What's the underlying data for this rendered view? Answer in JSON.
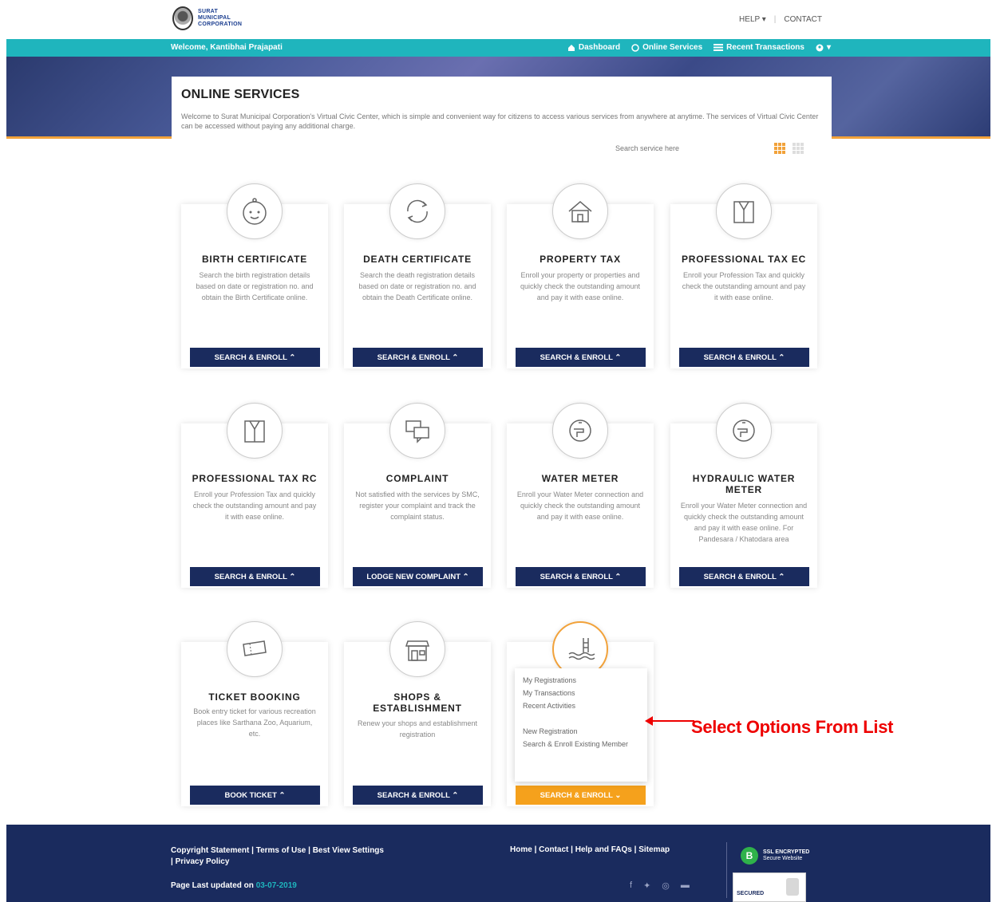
{
  "header": {
    "logo_line1": "SURAT",
    "logo_line2": "MUNICIPAL",
    "logo_line3": "CORPORATION",
    "help_label": "HELP ▾",
    "contact_label": "CONTACT"
  },
  "nav": {
    "welcome": "Welcome, Kantibhai Prajapati",
    "dashboard": "Dashboard",
    "online_services": "Online Services",
    "recent_transactions": "Recent Transactions",
    "user_menu": "▾"
  },
  "intro": {
    "title": "ONLINE SERVICES",
    "description": "Welcome to Surat Municipal Corporation's Virtual Civic Center, which is simple and convenient way for citizens to access various services from anywhere at anytime. The services of Virtual Civic Center can be accessed without paying any additional charge.",
    "search_placeholder": "Search service here"
  },
  "cards": [
    {
      "icon": "baby-icon",
      "title": "BIRTH CERTIFICATE",
      "desc": "Search the birth registration details based on date or registration no. and obtain the Birth Certificate online.",
      "button": "SEARCH & ENROLL ⌃"
    },
    {
      "icon": "cycle-icon",
      "title": "DEATH CERTIFICATE",
      "desc": "Search the death registration details based on date or registration no. and obtain the Death Certificate online.",
      "button": "SEARCH & ENROLL ⌃"
    },
    {
      "icon": "house-icon",
      "title": "PROPERTY TAX",
      "desc": "Enroll your property or properties and quickly check the outstanding amount and pay it with ease online.",
      "button": "SEARCH & ENROLL ⌃"
    },
    {
      "icon": "suit-icon",
      "title": "PROFESSIONAL TAX EC",
      "desc": "Enroll your Profession Tax and quickly check the outstanding amount and pay it with ease online.",
      "button": "SEARCH & ENROLL ⌃"
    },
    {
      "icon": "suit-icon",
      "title": "PROFESSIONAL TAX RC",
      "desc": "Enroll your Profession Tax and quickly check the outstanding amount and pay it with ease online.",
      "button": "SEARCH & ENROLL ⌃"
    },
    {
      "icon": "chat-icon",
      "title": "COMPLAINT",
      "desc": "Not satisfied with the services by SMC, register your complaint and track the complaint status.",
      "button": "LODGE NEW COMPLAINT ⌃"
    },
    {
      "icon": "water-tap-icon",
      "title": "WATER METER",
      "desc": "Enroll your Water Meter connection and quickly check the outstanding amount and pay it with ease online.",
      "button": "SEARCH & ENROLL ⌃"
    },
    {
      "icon": "water-tap-icon",
      "title": "HYDRAULIC WATER METER",
      "desc": "Enroll your Water Meter connection and quickly check the outstanding amount and pay it with ease online. For Pandesara / Khatodara area",
      "button": "SEARCH & ENROLL ⌃"
    },
    {
      "icon": "ticket-icon",
      "title": "TICKET BOOKING",
      "desc": "Book entry ticket for various recreation places like Sarthana Zoo, Aquarium, etc.",
      "button": "BOOK TICKET ⌃"
    },
    {
      "icon": "shop-icon",
      "title": "SHOPS & ESTABLISHMENT",
      "desc": "Renew your shops and establishment registration",
      "button": "SEARCH & ENROLL ⌃"
    },
    {
      "icon": "swimming-pool-icon",
      "title": "",
      "desc": "",
      "button": "SEARCH & ENROLL ⌄"
    }
  ],
  "dropdown": {
    "items": [
      "My Registrations",
      "My Transactions",
      "Recent Activities",
      "New Registration",
      "Search & Enroll Existing Member"
    ]
  },
  "annotation": {
    "text": "Select Options From List",
    "color": "#e00000"
  },
  "footer": {
    "copyright": "Copyright Statement",
    "terms": "Terms of Use",
    "best_view": "Best View Settings",
    "privacy": "Privacy Policy",
    "home": "Home",
    "contact": "Contact",
    "help": "Help and FAQs",
    "sitemap": "Sitemap",
    "updated_label": "Page Last updated on ",
    "updated_date": "03-07-2019",
    "ssl_line1": "SSL ENCRYPTED",
    "ssl_line2": "Secure Website",
    "seal_label": "SECURED"
  },
  "colors": {
    "nav_teal": "#1fb5bd",
    "navy": "#1a2b5e",
    "orange": "#f5a11c"
  }
}
